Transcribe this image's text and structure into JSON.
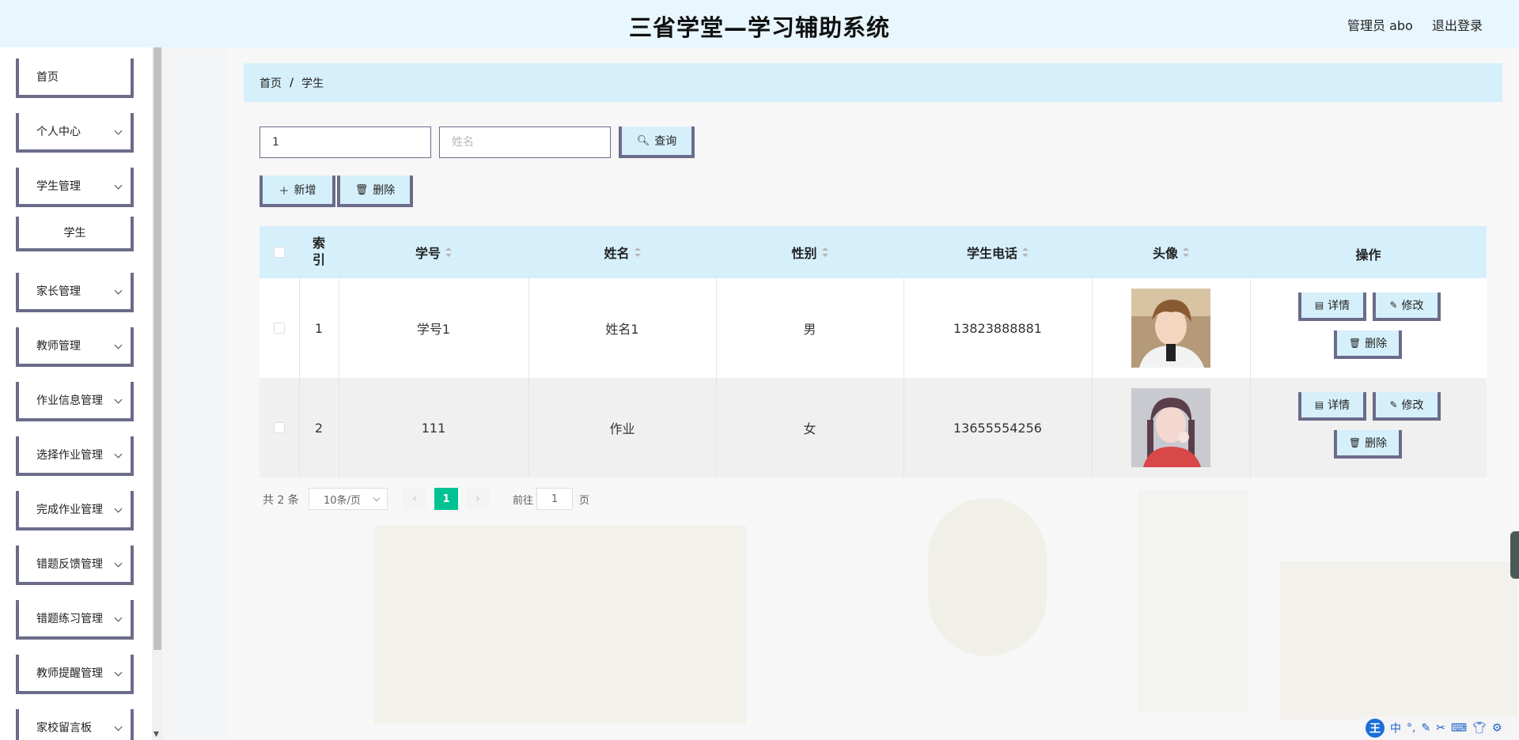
{
  "header": {
    "title": "三省学堂—学习辅助系统",
    "admin": "管理员 abo",
    "logout": "退出登录"
  },
  "sidebar": {
    "items": [
      {
        "label": "首页",
        "expandable": false
      },
      {
        "label": "个人中心",
        "expandable": true
      },
      {
        "label": "学生管理",
        "expandable": true
      },
      {
        "label": "学生",
        "expandable": false,
        "sub": true
      },
      {
        "label": "家长管理",
        "expandable": true
      },
      {
        "label": "教师管理",
        "expandable": true
      },
      {
        "label": "作业信息管理",
        "expandable": true
      },
      {
        "label": "选择作业管理",
        "expandable": true
      },
      {
        "label": "完成作业管理",
        "expandable": true
      },
      {
        "label": "错题反馈管理",
        "expandable": true
      },
      {
        "label": "错题练习管理",
        "expandable": true
      },
      {
        "label": "教师提醒管理",
        "expandable": true
      },
      {
        "label": "家校留言板",
        "expandable": true
      }
    ]
  },
  "breadcrumb": {
    "home": "首页",
    "separator": "/",
    "current": "学生"
  },
  "search": {
    "student_id_value": "1",
    "name_placeholder": "姓名",
    "query_label": "查询"
  },
  "toolbar": {
    "add_label": "新增",
    "delete_label": "删除"
  },
  "table": {
    "columns": {
      "index": "索\n引",
      "student_id": "学号",
      "name": "姓名",
      "gender": "性别",
      "phone": "学生电话",
      "avatar": "头像",
      "actions": "操作"
    },
    "rows": [
      {
        "index": "1",
        "student_id": "学号1",
        "name": "姓名1",
        "gender": "男",
        "phone": "13823888881"
      },
      {
        "index": "2",
        "student_id": "111",
        "name": "作业",
        "gender": "女",
        "phone": "13655554256"
      }
    ],
    "actions": {
      "detail": "详情",
      "edit": "修改",
      "delete": "删除"
    }
  },
  "pagination": {
    "total": "共 2 条",
    "page_size": "10条/页",
    "current_page": "1",
    "goto_prefix": "前往",
    "goto_value": "1",
    "goto_suffix": "页"
  },
  "ime": {
    "mode": "中"
  },
  "colors": {
    "accent": "#d6f0fb",
    "border": "#6b6b8a",
    "pager_active": "#00c292",
    "header_bg": "#e8f6fd"
  }
}
